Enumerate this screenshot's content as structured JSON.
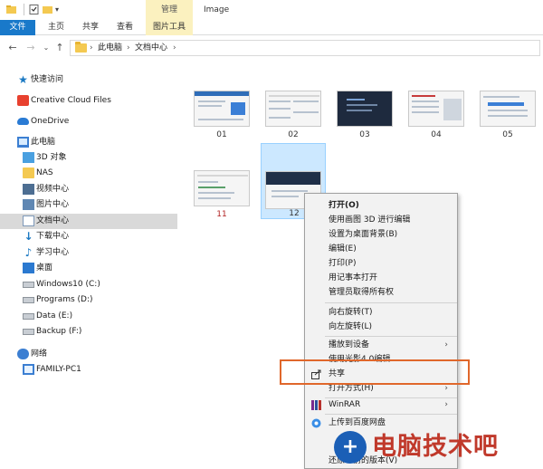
{
  "window": {
    "title": "Image",
    "context_tab_header": "管理"
  },
  "ribbon": {
    "tabs": [
      "文件",
      "主页",
      "共享",
      "查看",
      "图片工具"
    ]
  },
  "address": {
    "crumbs": [
      "此电脑",
      "文档中心"
    ]
  },
  "sidebar": {
    "items": [
      {
        "label": "快速访问",
        "icon": "star-icon"
      },
      {
        "label": "Creative Cloud Files",
        "icon": "creative-cloud-icon"
      },
      {
        "label": "OneDrive",
        "icon": "onedrive-cloud-icon"
      },
      {
        "label": "此电脑",
        "icon": "computer-icon"
      },
      {
        "label": "3D 对象",
        "icon": "3d-objects-icon"
      },
      {
        "label": "NAS",
        "icon": "folder-icon"
      },
      {
        "label": "视频中心",
        "icon": "video-folder-icon"
      },
      {
        "label": "图片中心",
        "icon": "pictures-folder-icon"
      },
      {
        "label": "文档中心",
        "icon": "documents-folder-icon",
        "selected": true
      },
      {
        "label": "下载中心",
        "icon": "download-icon"
      },
      {
        "label": "学习中心",
        "icon": "music-icon"
      },
      {
        "label": "桌面",
        "icon": "desktop-icon"
      },
      {
        "label": "Windows10 (C:)",
        "icon": "drive-icon"
      },
      {
        "label": "Programs (D:)",
        "icon": "drive-icon"
      },
      {
        "label": "Data (E:)",
        "icon": "drive-icon"
      },
      {
        "label": "Backup (F:)",
        "icon": "drive-icon"
      },
      {
        "label": "网络",
        "icon": "network-icon"
      },
      {
        "label": "FAMILY-PC1",
        "icon": "monitor-icon"
      }
    ]
  },
  "files": [
    {
      "name": "01"
    },
    {
      "name": "02"
    },
    {
      "name": "03"
    },
    {
      "name": "04"
    },
    {
      "name": "05"
    },
    {
      "name": "11"
    },
    {
      "name": "12",
      "selected": true
    }
  ],
  "context_menu": {
    "items": [
      {
        "label": "打开(O)",
        "bold": true
      },
      {
        "label": "使用画图 3D 进行编辑"
      },
      {
        "label": "设置为桌面背景(B)"
      },
      {
        "label": "编辑(E)"
      },
      {
        "label": "打印(P)"
      },
      {
        "label": "用记事本打开"
      },
      {
        "label": "管理员取得所有权"
      },
      {
        "label": "向右旋转(T)"
      },
      {
        "label": "向左旋转(L)"
      },
      {
        "label": "播放到设备",
        "submenu": true
      },
      {
        "label": "使用光影4.0编辑"
      },
      {
        "label": "共享",
        "icon": "share-icon"
      },
      {
        "label": "打开方式(H)",
        "submenu": true
      },
      {
        "label": "WinRAR",
        "icon": "winrar-icon",
        "submenu": true
      },
      {
        "label": "上传到百度网盘",
        "icon": "baidu-netdisk-icon"
      },
      {
        "label": "还原以前的版本(V)"
      }
    ]
  },
  "watermark": {
    "text": "电脑技术吧"
  }
}
